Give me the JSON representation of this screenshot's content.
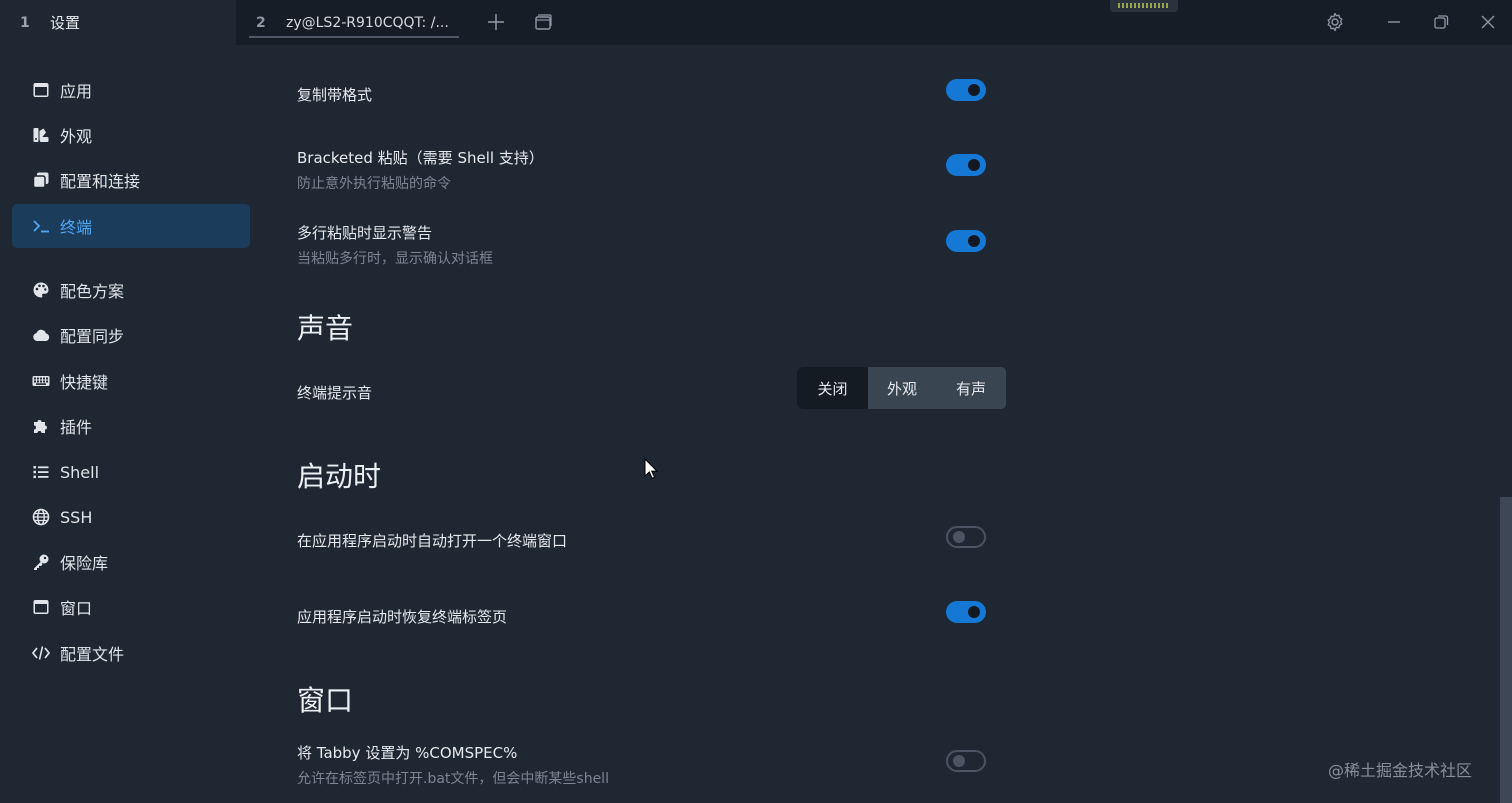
{
  "tabs": [
    {
      "num": "1",
      "title": "设置"
    },
    {
      "num": "2",
      "title": "zy@LS2-R910CQQT: /..."
    }
  ],
  "sidebar": {
    "items": [
      {
        "label": "应用",
        "icon": "window-icon"
      },
      {
        "label": "外观",
        "icon": "palette-swatch-icon"
      },
      {
        "label": "配置和连接",
        "icon": "copy-icon"
      },
      {
        "label": "终端",
        "icon": "terminal-prompt-icon"
      },
      {
        "label": "配色方案",
        "icon": "paint-palette-icon"
      },
      {
        "label": "配置同步",
        "icon": "cloud-icon"
      },
      {
        "label": "快捷键",
        "icon": "keyboard-icon"
      },
      {
        "label": "插件",
        "icon": "puzzle-icon"
      },
      {
        "label": "Shell",
        "icon": "list-icon"
      },
      {
        "label": "SSH",
        "icon": "globe-icon"
      },
      {
        "label": "保险库",
        "icon": "key-icon"
      },
      {
        "label": "窗口",
        "icon": "window-icon"
      },
      {
        "label": "配置文件",
        "icon": "code-icon"
      }
    ]
  },
  "main": {
    "copy_formatting": {
      "title": "复制带格式",
      "enabled": true
    },
    "bracketed_paste": {
      "title": "Bracketed 粘贴（需要 Shell 支持）",
      "desc": "防止意外执行粘贴的命令",
      "enabled": true
    },
    "multiline_warning": {
      "title": "多行粘贴时显示警告",
      "desc": "当粘贴多行时，显示确认对话框",
      "enabled": true
    },
    "sound_section": "声音",
    "terminal_bell": {
      "title": "终端提示音",
      "options": [
        "关闭",
        "外观",
        "有声"
      ],
      "selected": "关闭"
    },
    "startup_section": "启动时",
    "open_on_startup": {
      "title": "在应用程序启动时自动打开一个终端窗口",
      "enabled": false
    },
    "restore_tabs": {
      "title": "应用程序启动时恢复终端标签页",
      "enabled": true
    },
    "window_section": "窗口",
    "comspec": {
      "title": "将 Tabby 设置为 %COMSPEC%",
      "desc": "允许在标签页中打开.bat文件，但会中断某些shell",
      "enabled": false
    }
  },
  "watermark": "@稀土掘金技术社区",
  "colors": {
    "accent": "#1478d4",
    "active_nav_bg": "#1c3c5c",
    "active_nav_text": "#4fa6f6",
    "bg": "#1f2733"
  }
}
